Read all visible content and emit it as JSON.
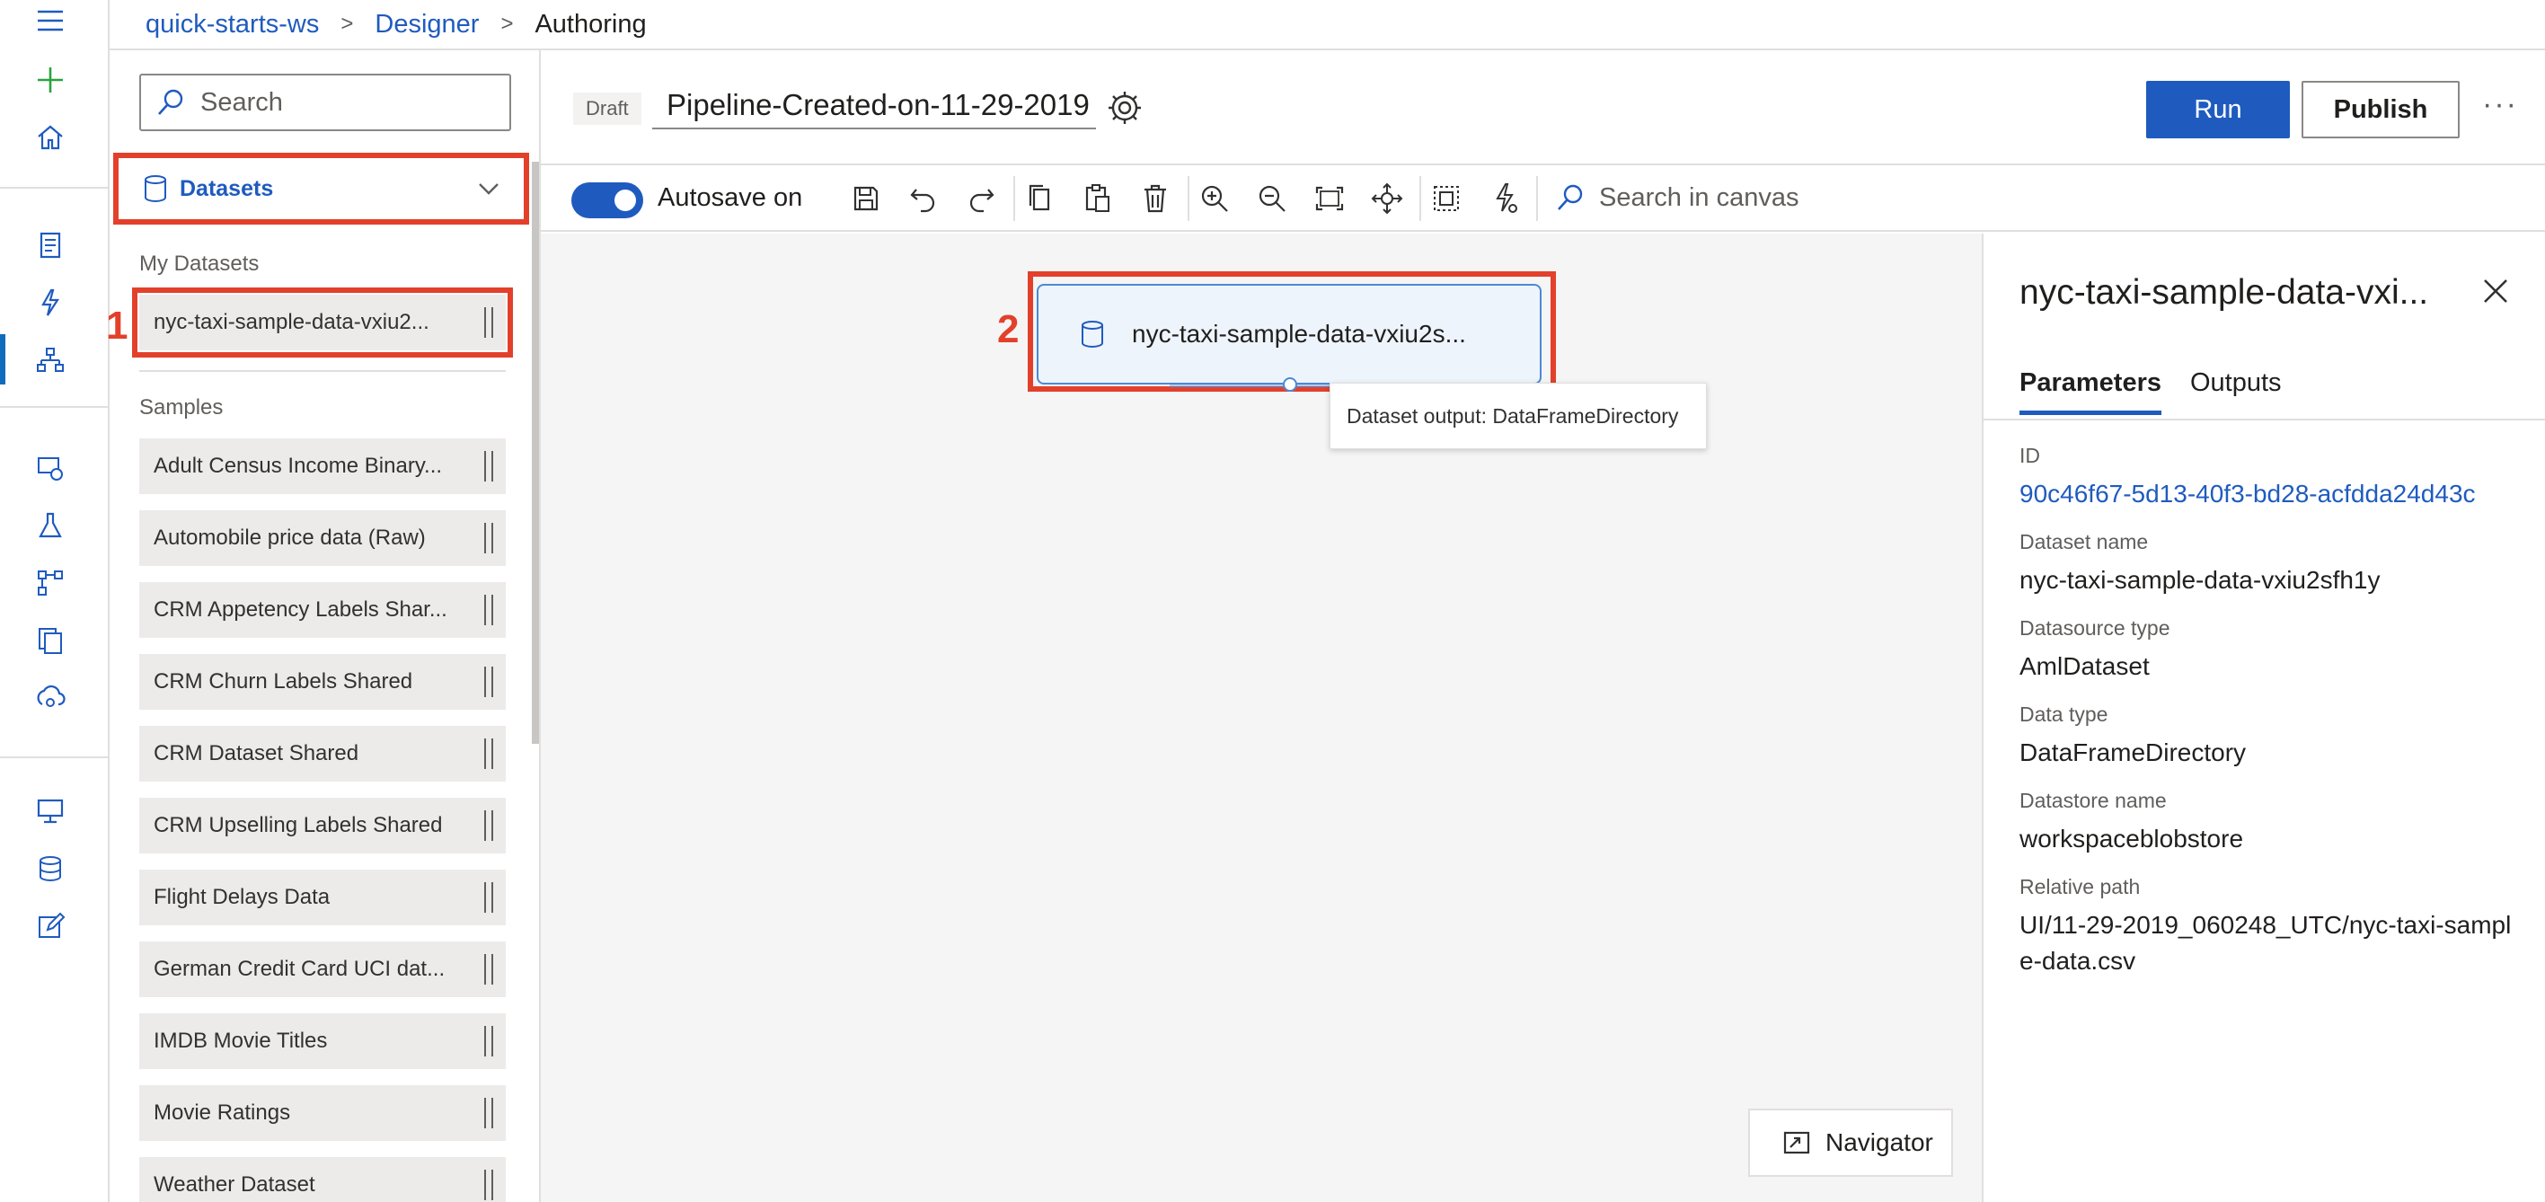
{
  "breadcrumb": {
    "workspace": "quick-starts-ws",
    "designer": "Designer",
    "current": "Authoring",
    "separator": ">"
  },
  "palette": {
    "search_placeholder": "Search",
    "category": "Datasets",
    "my_datasets_label": "My Datasets",
    "my_datasets": [
      "nyc-taxi-sample-data-vxiu2..."
    ],
    "samples_label": "Samples",
    "samples": [
      "Adult Census Income Binary...",
      "Automobile price data (Raw)",
      "CRM Appetency Labels Shar...",
      "CRM Churn Labels Shared",
      "CRM Dataset Shared",
      "CRM Upselling Labels Shared",
      "Flight Delays Data",
      "German Credit Card UCI dat...",
      "IMDB Movie Titles",
      "Movie Ratings",
      "Weather Dataset"
    ],
    "marker_1": "1"
  },
  "titlebar": {
    "draft_badge": "Draft",
    "pipeline_name": "Pipeline-Created-on-11-29-2019",
    "run_label": "Run",
    "publish_label": "Publish",
    "more_label": "···"
  },
  "toolbar": {
    "autosave_label": "Autosave on",
    "autosave_on": true,
    "canvas_search_placeholder": "Search in canvas",
    "icons": [
      "save-icon",
      "undo-icon",
      "redo-icon",
      "copy-icon",
      "paste-icon",
      "delete-icon",
      "zoom-in-icon",
      "zoom-out-icon",
      "fit-screen-icon",
      "pan-icon",
      "select-icon",
      "auto-layout-icon"
    ]
  },
  "canvas": {
    "marker_2": "2",
    "node_label": "nyc-taxi-sample-data-vxiu2s...",
    "tooltip": "Dataset output: DataFrameDirectory",
    "navigator_label": "Navigator"
  },
  "panel": {
    "title": "nyc-taxi-sample-data-vxi...",
    "tabs": [
      "Parameters",
      "Outputs"
    ],
    "props": [
      {
        "label": "ID",
        "value": "90c46f67-5d13-40f3-bd28-acfdda24d43c"
      },
      {
        "label": "Dataset name",
        "value": "nyc-taxi-sample-data-vxiu2sfh1y"
      },
      {
        "label": "Datasource type",
        "value": "AmlDataset"
      },
      {
        "label": "Data type",
        "value": "DataFrameDirectory"
      },
      {
        "label": "Datastore name",
        "value": "workspaceblobstore"
      },
      {
        "label": "Relative path",
        "value": "UI/11-29-2019_060248_UTC/nyc-taxi-sample-data.csv"
      }
    ]
  },
  "colors": {
    "accent": "#1f5bbf",
    "highlight": "#e3402b",
    "add_icon": "#2aa33d"
  }
}
